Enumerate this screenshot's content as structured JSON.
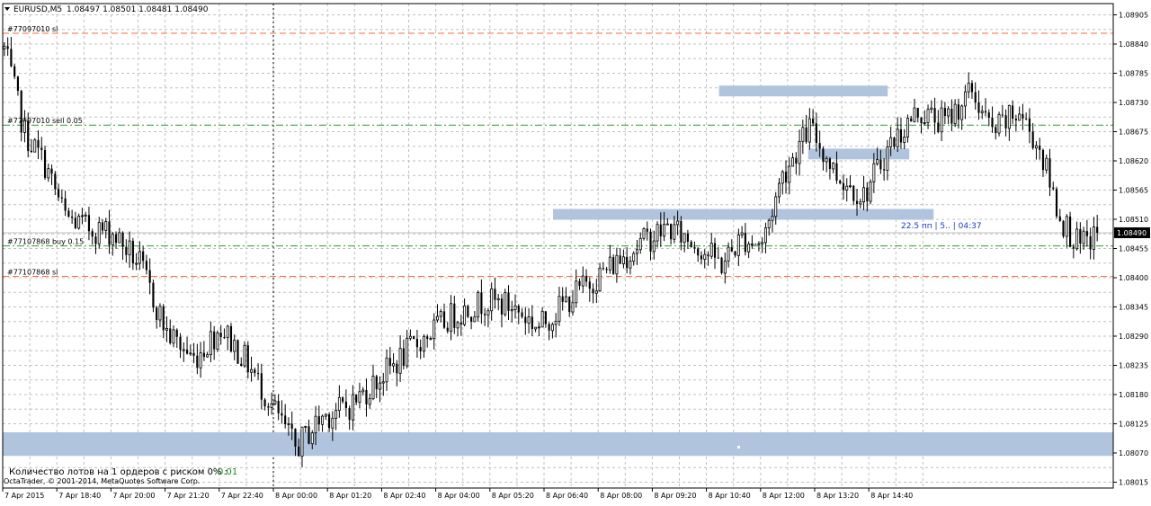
{
  "header": {
    "symbol": "EURUSD,M5",
    "ohlc": "1.08497 1.08501 1.08481 1.08490"
  },
  "footer": {
    "lots_label": "Количество лотов на 1 ордеров с риском 0% :",
    "lots_value": "0.01",
    "copyright": "OctaTrader, © 2001-2014, MetaQuotes Software Corp."
  },
  "live_info": "22.5 пп | 5.. | 04:37",
  "colors": {
    "candle": "#000000",
    "grid": "#c0c0c0",
    "sl_line": "#ff6a3d",
    "order_line": "#2e9b2e",
    "zone": "#b0c4de",
    "bid_line": "#c0c0c0",
    "price_tag_bg": "#000000",
    "info_text": "#1a3cc8",
    "lots_value": "#1e8c1e"
  },
  "order_levels": [
    {
      "label": "#77097010 sl",
      "price": 1.0887,
      "kind": "sl"
    },
    {
      "label": "#77097010 sell 0.05",
      "price": 1.08695,
      "kind": "order"
    },
    {
      "label": "#77107868 buy 0.15",
      "price": 1.08465,
      "kind": "order"
    },
    {
      "label": "#77107868 sl",
      "price": 1.08407,
      "kind": "sl"
    }
  ],
  "chart_data": {
    "type": "candlestick",
    "title": "EURUSD,M5",
    "y_ticks": [
      "1.08905",
      "1.08840",
      "1.08785",
      "1.08730",
      "1.08675",
      "1.08620",
      "1.08565",
      "1.08510",
      "1.08455",
      "1.08400",
      "1.08345",
      "1.08290",
      "1.08235",
      "1.08180",
      "1.08125",
      "1.08070",
      "1.08015"
    ],
    "ylim": [
      1.08015,
      1.08905
    ],
    "x_ticks": [
      "7 Apr 2015",
      "7 Apr 18:40",
      "7 Apr 20:00",
      "7 Apr 21:20",
      "7 Apr 22:40",
      "8 Apr 00:00",
      "8 Apr 01:20",
      "8 Apr 02:40",
      "8 Apr 04:00",
      "8 Apr 05:20",
      "8 Apr 06:40",
      "8 Apr 08:00",
      "8 Apr 09:20",
      "8 Apr 10:40",
      "8 Apr 12:00",
      "8 Apr 13:20",
      "8 Apr 14:40"
    ],
    "current_price": 1.0849,
    "grid": true,
    "period_separator": "8 Apr 00:00",
    "zones": [
      {
        "from_price": 1.08065,
        "to_price": 1.0811,
        "from_time": "7 Apr 2015",
        "to_time": "end"
      },
      {
        "from_price": 1.0852,
        "to_price": 1.0853,
        "from_time": "8 Apr 06:40",
        "to_time": "8 Apr 14:40+"
      },
      {
        "from_price": 1.08635,
        "to_price": 1.08645,
        "from_time": "8 Apr 14:00",
        "to_time": "8 Apr 14:40+"
      },
      {
        "from_price": 1.08755,
        "to_price": 1.08765,
        "from_time": "8 Apr 10:40",
        "to_time": "8 Apr 13:20+"
      }
    ],
    "waypoints": [
      [
        0,
        1.0884
      ],
      [
        6,
        1.0868
      ],
      [
        12,
        1.0862
      ],
      [
        18,
        1.0852
      ],
      [
        24,
        1.085
      ],
      [
        32,
        1.0849
      ],
      [
        40,
        1.0843
      ],
      [
        48,
        1.083
      ],
      [
        56,
        1.0825
      ],
      [
        64,
        1.0831
      ],
      [
        72,
        1.0824
      ],
      [
        80,
        1.0815
      ],
      [
        86,
        1.0808
      ],
      [
        94,
        1.0814
      ],
      [
        102,
        1.0816
      ],
      [
        112,
        1.0822
      ],
      [
        122,
        1.0828
      ],
      [
        132,
        1.0833
      ],
      [
        142,
        1.0836
      ],
      [
        150,
        1.0835
      ],
      [
        158,
        1.0831
      ],
      [
        168,
        1.0837
      ],
      [
        178,
        1.0842
      ],
      [
        188,
        1.0847
      ],
      [
        196,
        1.085
      ],
      [
        204,
        1.0847
      ],
      [
        212,
        1.0843
      ],
      [
        218,
        1.0848
      ],
      [
        224,
        1.0847
      ],
      [
        230,
        1.086
      ],
      [
        238,
        1.0869
      ],
      [
        246,
        1.086
      ],
      [
        254,
        1.0856
      ],
      [
        262,
        1.0866
      ],
      [
        270,
        1.0872
      ],
      [
        278,
        1.087
      ],
      [
        286,
        1.0876
      ],
      [
        292,
        1.0868
      ],
      [
        300,
        1.0872
      ],
      [
        306,
        1.0865
      ],
      [
        312,
        1.0852
      ],
      [
        318,
        1.0846
      ],
      [
        323,
        1.0849
      ]
    ]
  }
}
